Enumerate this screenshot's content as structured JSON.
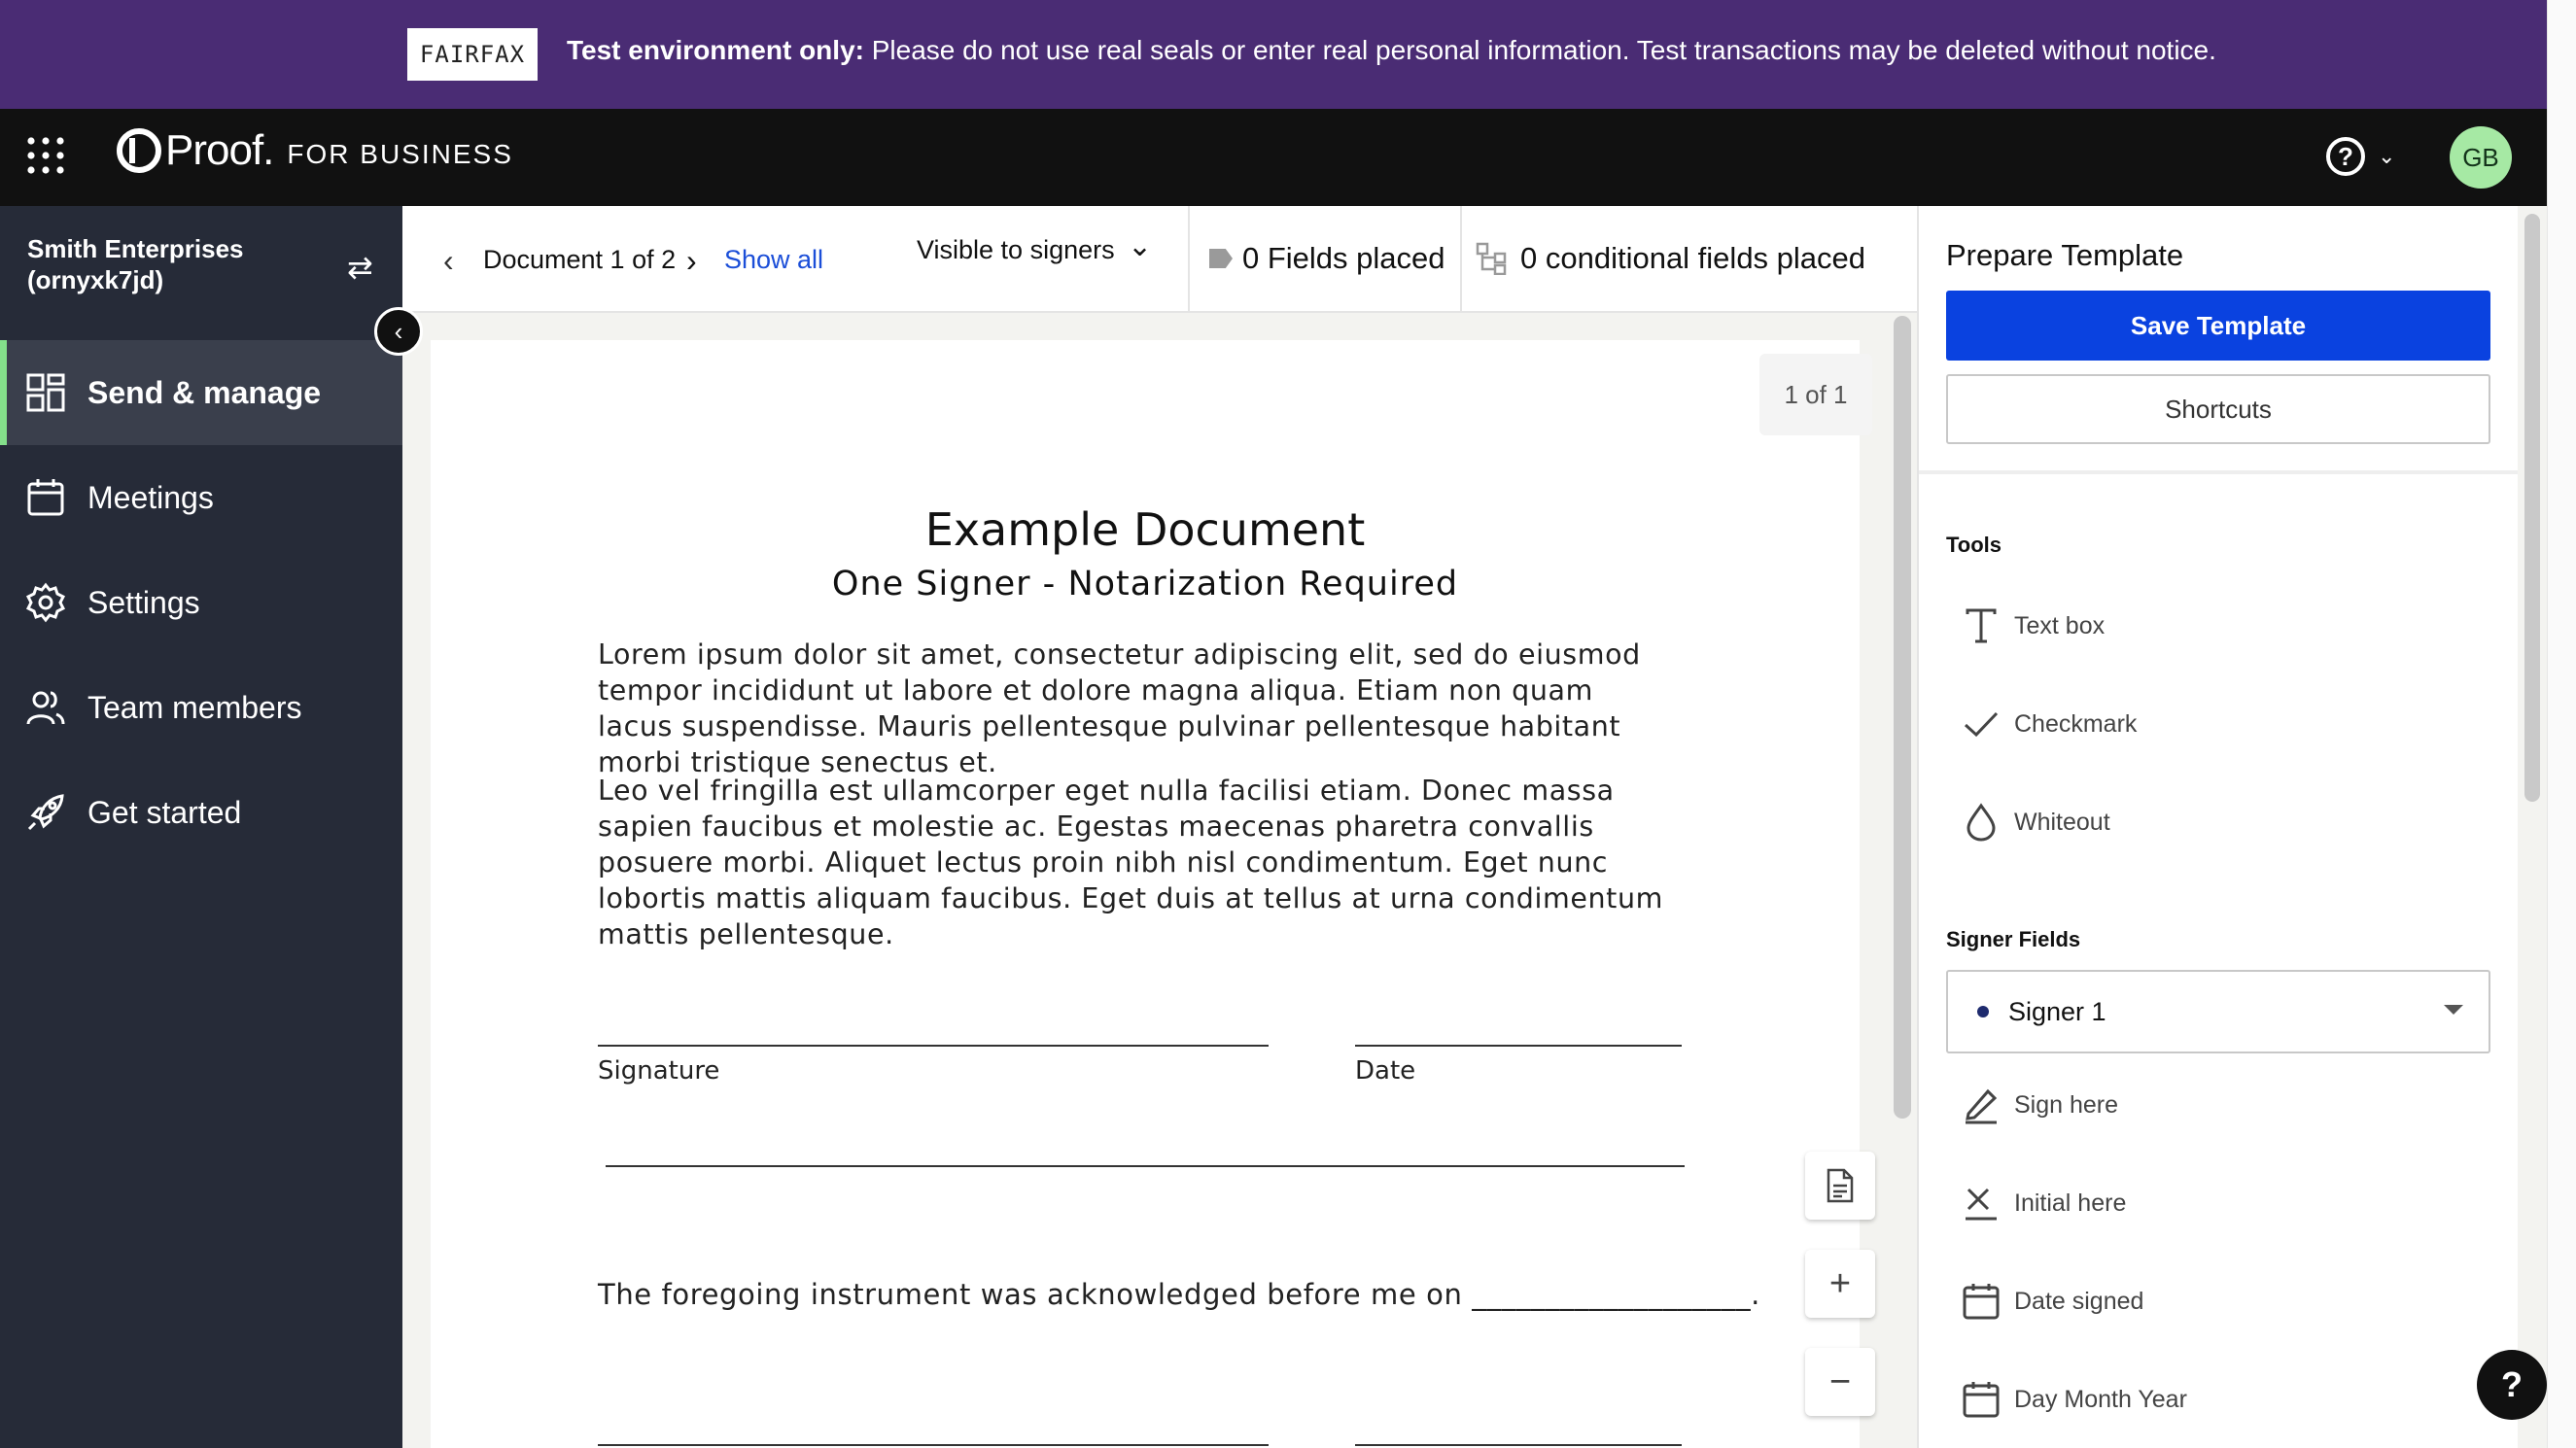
{
  "banner": {
    "logo_text": "FAIRFAX",
    "bold_text": "Test environment only:",
    "message": " Please do not use real seals or enter real personal information. Test transactions may be deleted without notice."
  },
  "topnav": {
    "brand_name": "Proof.",
    "brand_sub": "FOR BUSINESS",
    "help_glyph": "?",
    "avatar_initials": "GB"
  },
  "sidebar": {
    "org_name": "Smith Enterprises",
    "org_id": "(ornyxk7jd)",
    "items": [
      {
        "label": "Send & manage",
        "icon": "grid-dashboard-icon",
        "active": true
      },
      {
        "label": "Meetings",
        "icon": "calendar-icon",
        "active": false
      },
      {
        "label": "Settings",
        "icon": "gear-icon",
        "active": false
      },
      {
        "label": "Team members",
        "icon": "team-icon",
        "active": false
      },
      {
        "label": "Get started",
        "icon": "rocket-icon",
        "active": false
      }
    ]
  },
  "toolbar": {
    "document_label": "Document 1 of 2",
    "show_all": "Show all",
    "visibility": "Visible to signers",
    "fields_placed": "0 Fields placed",
    "conditional_fields": "0 conditional fields placed"
  },
  "document": {
    "page_count": "1 of 1",
    "title": "Example Document",
    "subtitle": "One Signer - Notarization Required",
    "paragraph1": "Lorem ipsum dolor sit amet, consectetur adipiscing elit, sed do eiusmod tempor incididunt ut labore et dolore magna aliqua. Etiam non quam lacus suspendisse. Mauris pellentesque pulvinar pellentesque habitant morbi tristique senectus et.",
    "paragraph2": "Leo vel fringilla est ullamcorper eget nulla facilisi etiam. Donec massa sapien faucibus et molestie ac. Egestas maecenas pharetra convallis posuere morbi. Aliquet lectus proin nibh nisl condimentum. Eget nunc lobortis mattis aliquam faucibus. Eget duis at tellus at urna condimentum mattis pellentesque.",
    "signature_label": "Signature",
    "date_label": "Date",
    "acknowledgement": "The foregoing instrument was acknowledged before me on ___________________."
  },
  "panel": {
    "title": "Prepare Template",
    "save_button": "Save Template",
    "shortcuts_button": "Shortcuts",
    "tools_heading": "Tools",
    "tools": [
      {
        "label": "Text box",
        "icon": "text-icon"
      },
      {
        "label": "Checkmark",
        "icon": "checkmark-icon"
      },
      {
        "label": "Whiteout",
        "icon": "droplet-icon"
      }
    ],
    "signer_heading": "Signer Fields",
    "signer_selected": "Signer 1",
    "signer_fields": [
      {
        "label": "Sign here",
        "icon": "pen-icon"
      },
      {
        "label": "Initial here",
        "icon": "initial-x-icon"
      },
      {
        "label": "Date signed",
        "icon": "calendar-icon"
      },
      {
        "label": "Day Month Year",
        "icon": "calendar-icon"
      }
    ]
  },
  "colors": {
    "banner_bg": "#4a2c74",
    "nav_bg": "#111111",
    "sidebar_bg": "#262b38",
    "active_accent": "#84e08b",
    "primary_button": "#0a42e0",
    "link": "#1b4ed8",
    "avatar_bg": "#a6e9a4"
  }
}
